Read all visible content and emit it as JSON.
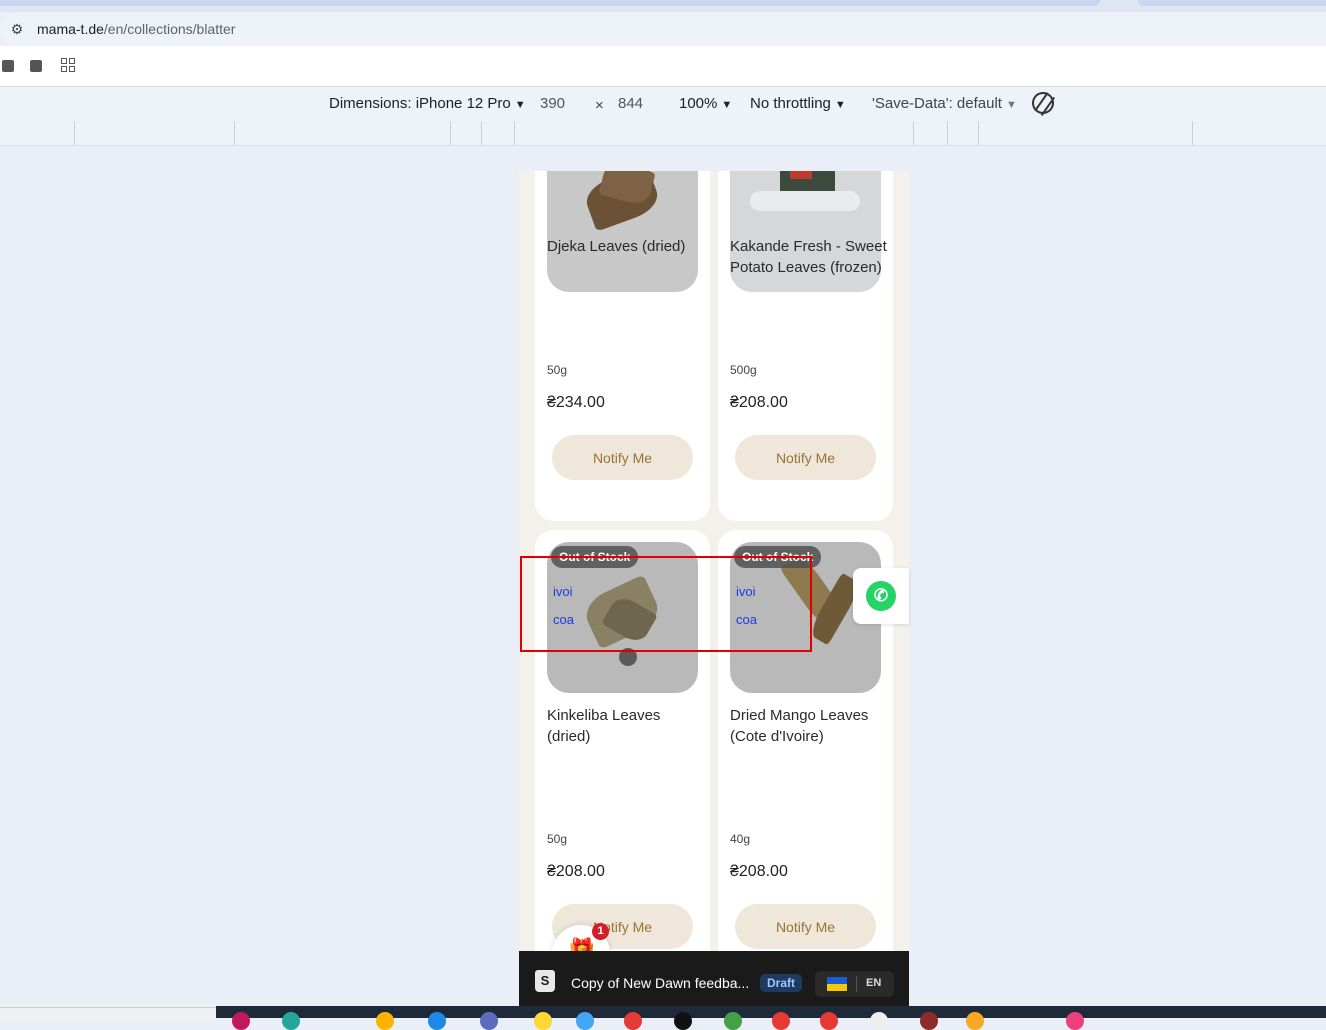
{
  "browser": {
    "url_host": "mama-t.de",
    "url_path": "/en/collections/blatter"
  },
  "device_toolbar": {
    "dimensions_label": "Dimensions: iPhone 12 Pro",
    "width": "390",
    "times": "×",
    "height": "844",
    "zoom": "100%",
    "throttling": "No throttling",
    "save_data": "'Save-Data': default"
  },
  "products": [
    {
      "title": "Djeka Leaves (dried)",
      "weight": "50g",
      "price": "₴234.00",
      "button": "Notify Me"
    },
    {
      "title": "Kakande Fresh - Sweet Potato Leaves (frozen)",
      "weight": "500g",
      "price": "₴208.00",
      "button": "Notify Me"
    },
    {
      "title": "Kinkeliba Leaves (dried)",
      "weight": "50g",
      "price": "₴208.00",
      "button": "Notify Me",
      "badge": "Out of Stock",
      "broken_img_text": "ivoi coa"
    },
    {
      "title": "Dried Mango Leaves (Cote d'Ivoire)",
      "weight": "40g",
      "price": "₴208.00",
      "button": "Notify Me",
      "badge": "Out of Stock",
      "broken_img_text": "ivoi coa"
    }
  ],
  "gift": {
    "badge_count": "1"
  },
  "preview_bar": {
    "theme_name": "Copy of New Dawn feedba...",
    "status": "Draft",
    "locale": "EN"
  },
  "colors": {
    "accent_button_bg": "#efe7da",
    "accent_button_text": "#9a7236",
    "whatsapp": "#25d366",
    "selection": "#e00000"
  }
}
